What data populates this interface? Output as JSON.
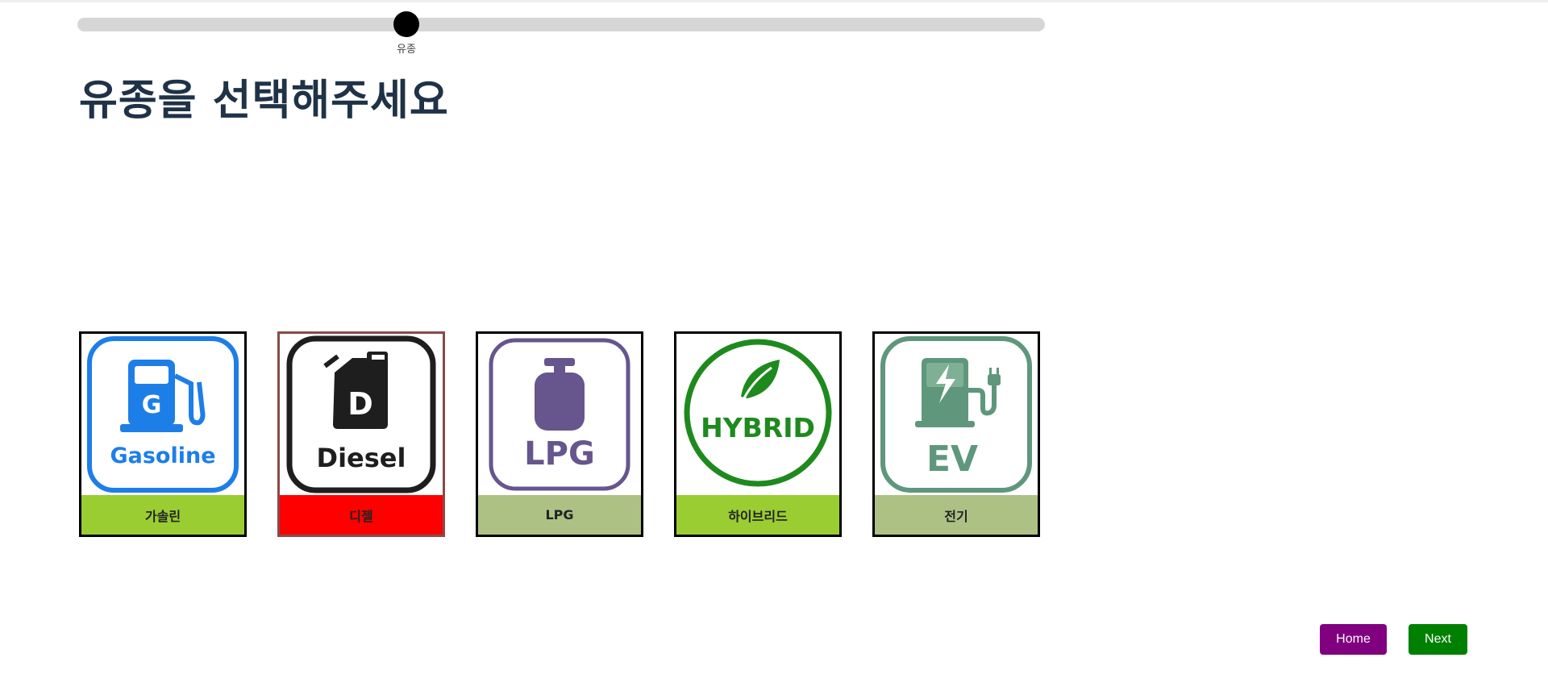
{
  "progress": {
    "step_label": "유종",
    "value_fraction": 0.34,
    "track_color": "#d6d6d6",
    "thumb_color": "#000000"
  },
  "page": {
    "title": "유종을 선택해주세요"
  },
  "fuel_options": [
    {
      "id": "gasoline",
      "icon_text": "Gasoline",
      "icon_letter": "G",
      "label": "가솔린",
      "label_color": "#9acd32",
      "icon_color": "#1e7ee8",
      "selected": false
    },
    {
      "id": "diesel",
      "icon_text": "Diesel",
      "icon_letter": "D",
      "label": "디젤",
      "label_color": "#ff0000",
      "icon_color": "#1e1e1e",
      "selected": true
    },
    {
      "id": "lpg",
      "icon_text": "LPG",
      "label": "LPG",
      "label_color": "#adc185",
      "icon_color": "#67558d",
      "selected": false
    },
    {
      "id": "hybrid",
      "icon_text": "HYBRID",
      "label": "하이브리드",
      "label_color": "#9acd32",
      "icon_color": "#1e8a1e",
      "selected": false
    },
    {
      "id": "ev",
      "icon_text": "EV",
      "label": "전기",
      "label_color": "#adc185",
      "icon_color": "#5f977c",
      "selected": false
    }
  ],
  "buttons": {
    "home_label": "Home",
    "next_label": "Next",
    "home_color": "#800080",
    "next_color": "#008000"
  }
}
